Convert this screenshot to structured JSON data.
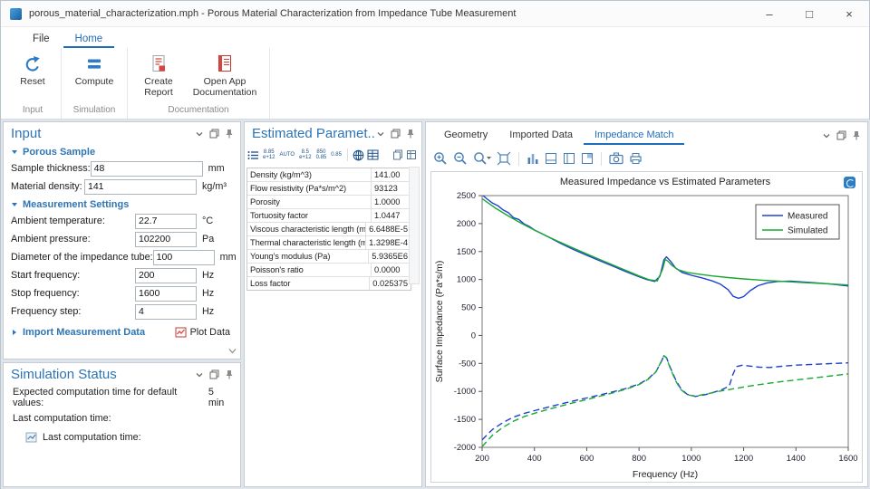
{
  "window": {
    "title": "porous_material_characterization.mph - Porous Material Characterization from Impedance Tube Measurement",
    "minimize": "–",
    "maximize": "□",
    "close": "×"
  },
  "menu": {
    "file": "File",
    "home": "Home"
  },
  "ribbon": {
    "reset": "Reset",
    "compute": "Compute",
    "create_report": "Create Report",
    "open_docs": "Open App Documentation",
    "group_input": "Input",
    "group_simulation": "Simulation",
    "group_documentation": "Documentation"
  },
  "input_panel": {
    "title": "Input",
    "section_porous": "Porous Sample",
    "section_measurement": "Measurement Settings",
    "rows_porous": [
      {
        "label": "Sample thickness:",
        "value": "48",
        "unit": "mm"
      },
      {
        "label": "Material density:",
        "value": "141",
        "unit": "kg/m³"
      }
    ],
    "rows_measurement": [
      {
        "label": "Ambient temperature:",
        "value": "22.7",
        "unit": "°C"
      },
      {
        "label": "Ambient pressure:",
        "value": "102200",
        "unit": "Pa"
      },
      {
        "label": "Diameter of the impedance tube:",
        "value": "100",
        "unit": "mm"
      },
      {
        "label": "Start frequency:",
        "value": "200",
        "unit": "Hz"
      },
      {
        "label": "Stop frequency:",
        "value": "1600",
        "unit": "Hz"
      },
      {
        "label": "Frequency step:",
        "value": "4",
        "unit": "Hz"
      }
    ],
    "import_section": "Import Measurement Data",
    "plot_data_button": "Plot Data"
  },
  "status_panel": {
    "title": "Simulation Status",
    "expected_label": "Expected computation time for default values:",
    "expected_value": "5 min",
    "last_label": "Last computation time:",
    "last_label2": "Last computation time:"
  },
  "params_panel": {
    "title": "Estimated Paramet...",
    "toolbar": {
      "fmt_exp": "8.85\ne+12",
      "fmt_auto": "AUTO",
      "fmt_sci": "8.5\ne+12",
      "fmt_dec": "850\n0.85",
      "fmt_085": "0.85"
    },
    "rows": [
      {
        "name": "Density (kg/m^3)",
        "value": "141.00"
      },
      {
        "name": "Flow resistivity (Pa*s/m^2)",
        "value": "93123"
      },
      {
        "name": "Porosity",
        "value": "1.0000"
      },
      {
        "name": "Tortuosity factor",
        "value": "1.0447"
      },
      {
        "name": "Viscous characteristic length (m)",
        "value": "6.6488E-5"
      },
      {
        "name": "Thermal characteristic length (m)",
        "value": "1.3298E-4"
      },
      {
        "name": "Young's modulus (Pa)",
        "value": "5.9365E6"
      },
      {
        "name": "Poisson's ratio",
        "value": "0.0000"
      },
      {
        "name": "Loss factor",
        "value": "0.025375"
      }
    ]
  },
  "graphics_panel": {
    "tab_geometry": "Geometry",
    "tab_imported": "Imported Data",
    "tab_impedance": "Impedance Match"
  },
  "colors": {
    "accent": "#1f6dbb",
    "header_blue": "#2d74b5",
    "measured": "#2040d0",
    "simulated": "#18a832"
  },
  "chart_data": {
    "type": "line",
    "title": "Measured Impedance vs Estimated Parameters",
    "xlabel": "Frequency (Hz)",
    "ylabel": "Surface Impedance (Pa*s/m)",
    "xlim": [
      200,
      1600
    ],
    "ylim": [
      -2000,
      2500
    ],
    "xticks": [
      200,
      400,
      600,
      800,
      1000,
      1200,
      1400,
      1600
    ],
    "yticks": [
      -2000,
      -1500,
      -1000,
      -500,
      0,
      500,
      1000,
      1500,
      2000,
      2500
    ],
    "grid": false,
    "legend": [
      "Measured",
      "Simulated"
    ],
    "legend_position": "top-right",
    "series": [
      {
        "name": "Measured (real part)",
        "color": "#2040d0",
        "dash": "solid",
        "x": [
          200,
          220,
          240,
          260,
          280,
          300,
          320,
          340,
          360,
          380,
          400,
          430,
          460,
          500,
          550,
          600,
          650,
          700,
          750,
          800,
          830,
          860,
          880,
          895,
          905,
          920,
          940,
          965,
          1000,
          1040,
          1080,
          1110,
          1140,
          1160,
          1180,
          1200,
          1225,
          1255,
          1290,
          1330,
          1380,
          1430,
          1480,
          1530,
          1600
        ],
        "y": [
          2515,
          2435,
          2365,
          2320,
          2245,
          2195,
          2105,
          2075,
          1995,
          1950,
          1885,
          1815,
          1745,
          1645,
          1535,
          1435,
          1335,
          1240,
          1140,
          1050,
          1000,
          965,
          1060,
          1350,
          1405,
          1330,
          1205,
          1125,
          1075,
          1030,
          975,
          920,
          820,
          700,
          665,
          695,
          800,
          890,
          940,
          965,
          970,
          955,
          940,
          920,
          885
        ]
      },
      {
        "name": "Simulated (real part)",
        "color": "#18a832",
        "dash": "solid",
        "x": [
          200,
          250,
          300,
          350,
          400,
          450,
          500,
          550,
          600,
          650,
          700,
          750,
          800,
          840,
          870,
          890,
          900,
          910,
          925,
          950,
          985,
          1030,
          1080,
          1140,
          1200,
          1270,
          1340,
          1420,
          1500,
          1600
        ],
        "y": [
          2445,
          2280,
          2135,
          2005,
          1885,
          1770,
          1662,
          1558,
          1458,
          1358,
          1260,
          1162,
          1065,
          995,
          975,
          1180,
          1360,
          1330,
          1255,
          1175,
          1125,
          1095,
          1065,
          1035,
          1010,
          988,
          968,
          948,
          928,
          902
        ]
      },
      {
        "name": "Measured (imaginary part)",
        "color": "#2040d0",
        "dash": "dashed",
        "x": [
          200,
          240,
          280,
          320,
          360,
          400,
          450,
          500,
          550,
          600,
          650,
          700,
          750,
          800,
          835,
          865,
          885,
          895,
          905,
          920,
          940,
          960,
          985,
          1015,
          1050,
          1090,
          1120,
          1145,
          1158,
          1172,
          1195,
          1225,
          1260,
          1300,
          1345,
          1395,
          1450,
          1510,
          1560,
          1600
        ],
        "y": [
          -1865,
          -1680,
          -1555,
          -1460,
          -1395,
          -1345,
          -1285,
          -1225,
          -1170,
          -1118,
          -1062,
          -1008,
          -948,
          -868,
          -775,
          -645,
          -470,
          -362,
          -395,
          -580,
          -790,
          -952,
          -1055,
          -1090,
          -1062,
          -1010,
          -962,
          -905,
          -705,
          -558,
          -532,
          -548,
          -568,
          -572,
          -552,
          -532,
          -520,
          -508,
          -498,
          -490
        ]
      },
      {
        "name": "Simulated (imaginary part)",
        "color": "#18a832",
        "dash": "dashed",
        "x": [
          200,
          240,
          280,
          320,
          360,
          400,
          450,
          500,
          550,
          600,
          650,
          700,
          750,
          800,
          835,
          865,
          885,
          895,
          905,
          920,
          940,
          960,
          985,
          1015,
          1055,
          1100,
          1150,
          1200,
          1250,
          1300,
          1350,
          1400,
          1450,
          1500,
          1550,
          1600
        ],
        "y": [
          -1985,
          -1782,
          -1640,
          -1532,
          -1452,
          -1392,
          -1325,
          -1262,
          -1202,
          -1145,
          -1085,
          -1025,
          -960,
          -878,
          -785,
          -650,
          -462,
          -360,
          -400,
          -595,
          -810,
          -968,
          -1062,
          -1082,
          -1048,
          -1005,
          -962,
          -922,
          -885,
          -852,
          -822,
          -795,
          -768,
          -742,
          -715,
          -688
        ]
      }
    ]
  }
}
